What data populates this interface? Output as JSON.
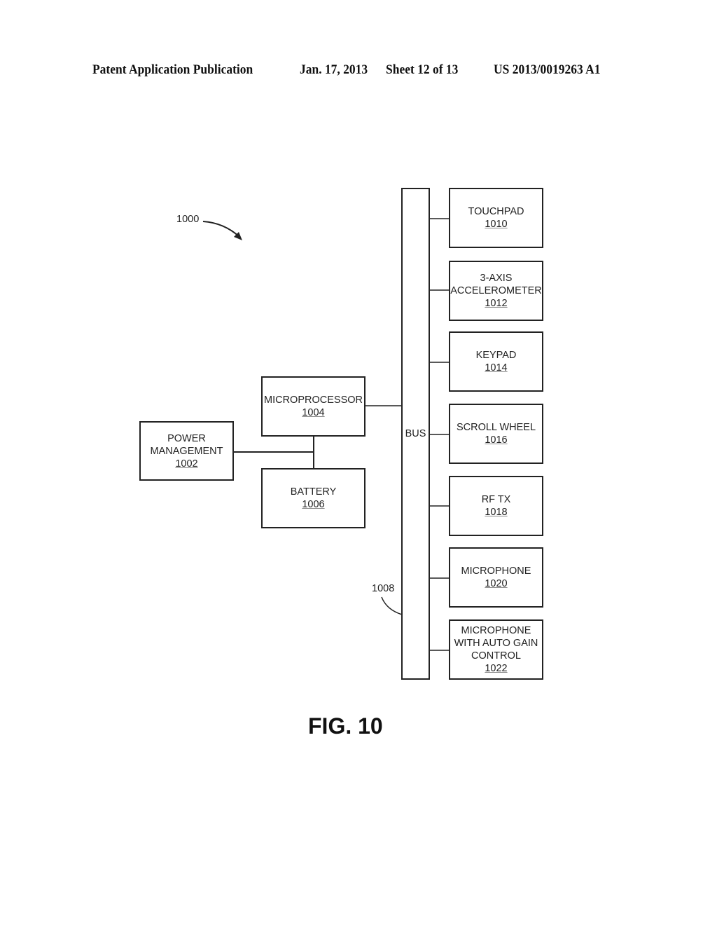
{
  "header": {
    "publication": "Patent Application Publication",
    "date": "Jan. 17, 2013",
    "sheet": "Sheet 12 of 13",
    "number": "US 2013/0019263 A1"
  },
  "figure": {
    "ref_label": "1000",
    "caption": "FIG. 10",
    "bus": {
      "label": "BUS",
      "ref": "1008"
    },
    "blocks": {
      "power_management": {
        "label": "POWER\nMANAGEMENT",
        "ref": "1002"
      },
      "microprocessor": {
        "label": "MICROPROCESSOR",
        "ref": "1004"
      },
      "battery": {
        "label": "BATTERY",
        "ref": "1006"
      }
    },
    "peripherals": [
      {
        "label": "TOUCHPAD",
        "ref": "1010"
      },
      {
        "label": "3-AXIS\nACCELEROMETER",
        "ref": "1012"
      },
      {
        "label": "KEYPAD",
        "ref": "1014"
      },
      {
        "label": "SCROLL WHEEL",
        "ref": "1016"
      },
      {
        "label": "RF TX",
        "ref": "1018"
      },
      {
        "label": "MICROPHONE",
        "ref": "1020"
      },
      {
        "label": "MICROPHONE\nWITH AUTO GAIN\nCONTROL",
        "ref": "1022"
      }
    ]
  }
}
